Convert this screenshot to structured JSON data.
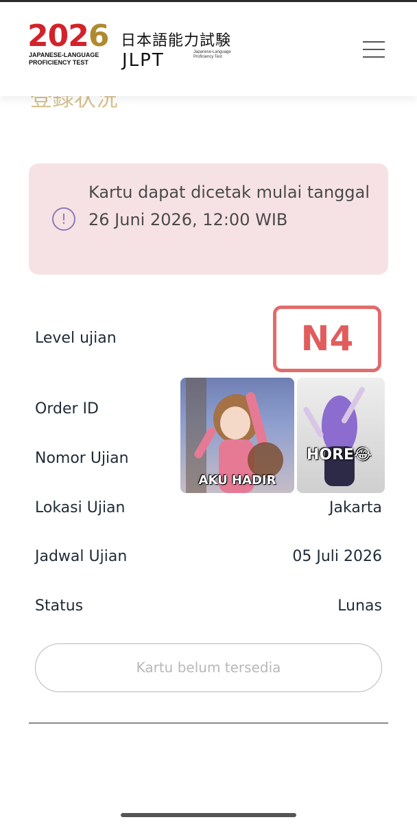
{
  "header": {
    "logo": {
      "year_main": "202",
      "year_accent": "6",
      "subtitle": "JAPANESE-LANGUAGE PROFICIENCY TEST",
      "kanji": "日本語能力試験",
      "jlpt": "JLPT",
      "jlpt_sub": "Japanese-Language Proficiency Test"
    },
    "menu_icon": "hamburger-menu-icon"
  },
  "page_heading": "登録状況",
  "alert": {
    "icon": "exclamation-circle-icon",
    "message": "Kartu dapat dicetak mulai tanggal 26 Juni 2026, 12:00 WIB"
  },
  "details": {
    "level": {
      "label": "Level ujian",
      "value": "N4"
    },
    "order_id": {
      "label": "Order ID",
      "value": ""
    },
    "exam_number": {
      "label": "Nomor Ujian",
      "value": ""
    },
    "location": {
      "label": "Lokasi Ujian",
      "value": "Jakarta"
    },
    "schedule": {
      "label": "Jadwal Ujian",
      "value": "05 Juli 2026"
    },
    "status": {
      "label": "Status",
      "value": "Lunas"
    }
  },
  "stickers": [
    {
      "caption": "AKU HADIR"
    },
    {
      "caption": "HORE😂"
    }
  ],
  "card_button": {
    "label": "Kartu belum tersedia"
  },
  "colors": {
    "accent_red": "#d2232a",
    "alert_bg": "#f6e2e4",
    "badge_red": "#e15c5c",
    "heading_gold": "#d6c28e"
  }
}
